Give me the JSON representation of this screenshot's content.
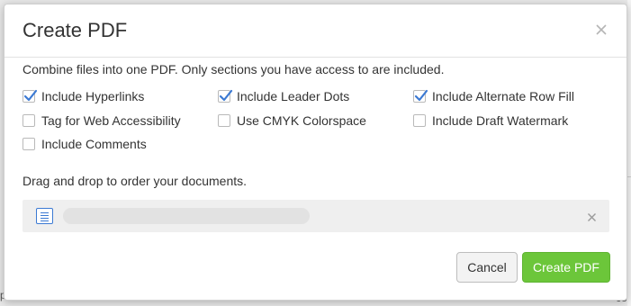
{
  "dialog": {
    "title": "Create PDF",
    "description": "Combine files into one PDF. Only sections you have access to are included.",
    "options": [
      {
        "label": "Include Hyperlinks",
        "checked": true
      },
      {
        "label": "Include Leader Dots",
        "checked": true
      },
      {
        "label": "Include Alternate Row Fill",
        "checked": true
      },
      {
        "label": "Tag for Web Accessibility",
        "checked": false
      },
      {
        "label": "Use CMYK Colorspace",
        "checked": false
      },
      {
        "label": "Include Draft Watermark",
        "checked": false
      },
      {
        "label": "Include Comments",
        "checked": false
      }
    ],
    "order_label": "Drag and drop to order your documents.",
    "documents": [
      {
        "icon": "document-icon",
        "name": ""
      }
    ],
    "buttons": {
      "cancel": "Cancel",
      "create": "Create PDF"
    },
    "colors": {
      "accent": "#3c7ad3",
      "primary_button": "#6cc63a"
    }
  },
  "background": {
    "fragment_1": "p",
    "fragment_2": "co"
  }
}
